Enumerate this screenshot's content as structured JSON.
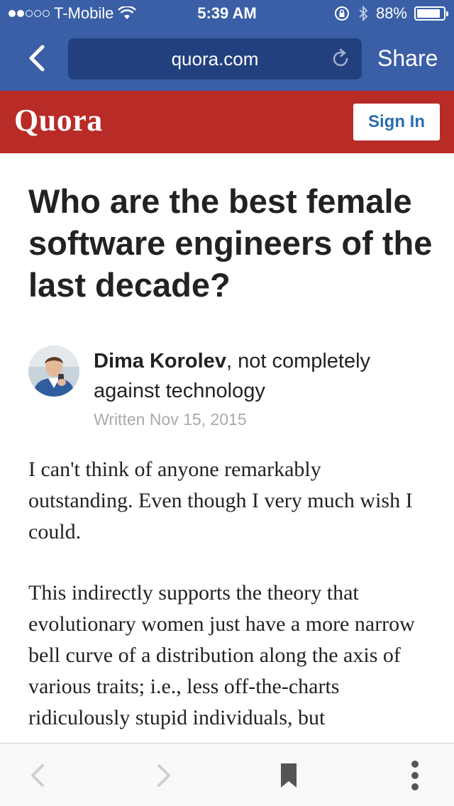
{
  "status_bar": {
    "carrier": "T-Mobile",
    "time": "5:39 AM",
    "battery_percent": "88%",
    "battery_level": 0.88,
    "signal_bars_filled": 2,
    "signal_bars_total": 5
  },
  "browser": {
    "url": "quora.com",
    "share_label": "Share"
  },
  "quora_header": {
    "logo": "Quora",
    "sign_in_label": "Sign In",
    "brand_color": "#b92b27"
  },
  "question": {
    "title": "Who are the best female software engineers of the last decade?"
  },
  "answer": {
    "author_name": "Dima Korolev",
    "author_credential": ", not completely against technology",
    "written": "Written Nov 15, 2015",
    "paragraphs": [
      "I can't think of anyone remarkably outstanding. Even though I very much wish I could.",
      "This indirectly supports the theory that evolutionary women just have a more narrow bell curve of a distribution along the axis of various traits; i.e., less off-the-charts ridiculously stupid individuals, but"
    ]
  },
  "toolbar": {
    "icons": [
      "back-arrow-icon",
      "forward-arrow-icon",
      "bookmark-icon",
      "more-vertical-icon"
    ]
  }
}
